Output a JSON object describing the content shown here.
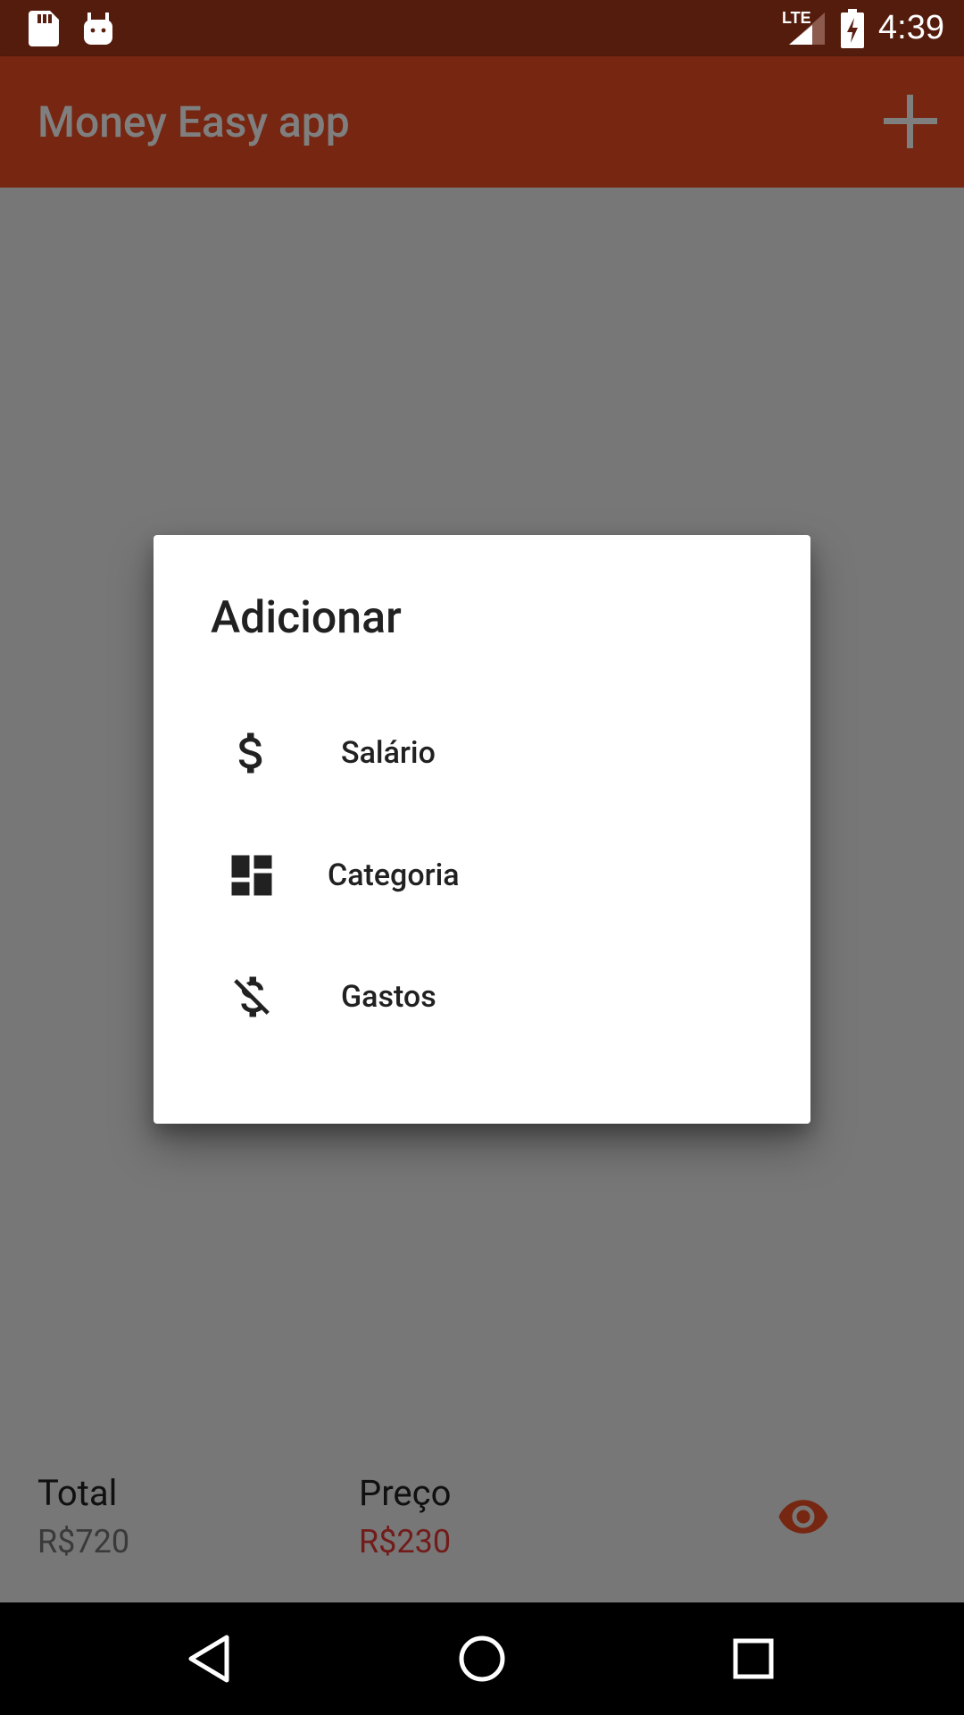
{
  "status_bar": {
    "time": "4:39",
    "network": "LTE",
    "icons": [
      "sd-card-icon",
      "android-icon",
      "signal-icon",
      "battery-charging-icon"
    ]
  },
  "app_bar": {
    "title": "Money Easy app",
    "action_icon": "plus-icon"
  },
  "summary": {
    "total_label": "Total",
    "total_value": "R$720",
    "price_label": "Preço",
    "price_value": "R$230",
    "visibility_icon": "eye-icon"
  },
  "dialog": {
    "title": "Adicionar",
    "options": [
      {
        "label": "Salário",
        "icon": "dollar-icon"
      },
      {
        "label": "Categoria",
        "icon": "dashboard-icon"
      },
      {
        "label": "Gastos",
        "icon": "money-off-icon"
      }
    ]
  },
  "nav_bar": {
    "icons": [
      "back-icon",
      "home-icon",
      "recents-icon"
    ]
  },
  "colors": {
    "primary": "#ec4d22",
    "primary_dark": "#a8391b",
    "price_red": "#e53935"
  }
}
